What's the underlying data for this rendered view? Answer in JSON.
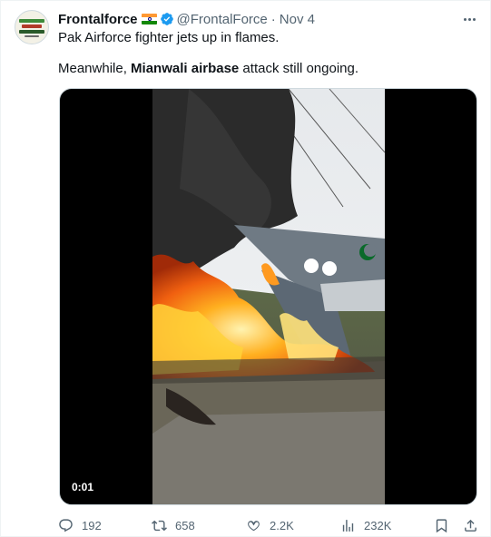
{
  "tweet": {
    "author_name": "Frontalforce",
    "handle": "@FrontalForce",
    "separator": "·",
    "date": "Nov 4",
    "flag_icon": "india-flag-icon",
    "verified_icon": "verified-badge-icon",
    "line1": "Pak Airforce fighter jets up in flames.",
    "line2_prefix": "Meanwhile, ",
    "line2_bold": "Mianwali airbase",
    "line2_suffix": " attack still ongoing."
  },
  "media": {
    "timestamp": "0:01"
  },
  "actions": {
    "replies": "192",
    "reposts": "658",
    "likes": "2.2K",
    "views": "232K"
  },
  "colors": {
    "text": "#0f1419",
    "muted": "#536471",
    "verified": "#1d9bf0",
    "border": "#cfd9de"
  }
}
